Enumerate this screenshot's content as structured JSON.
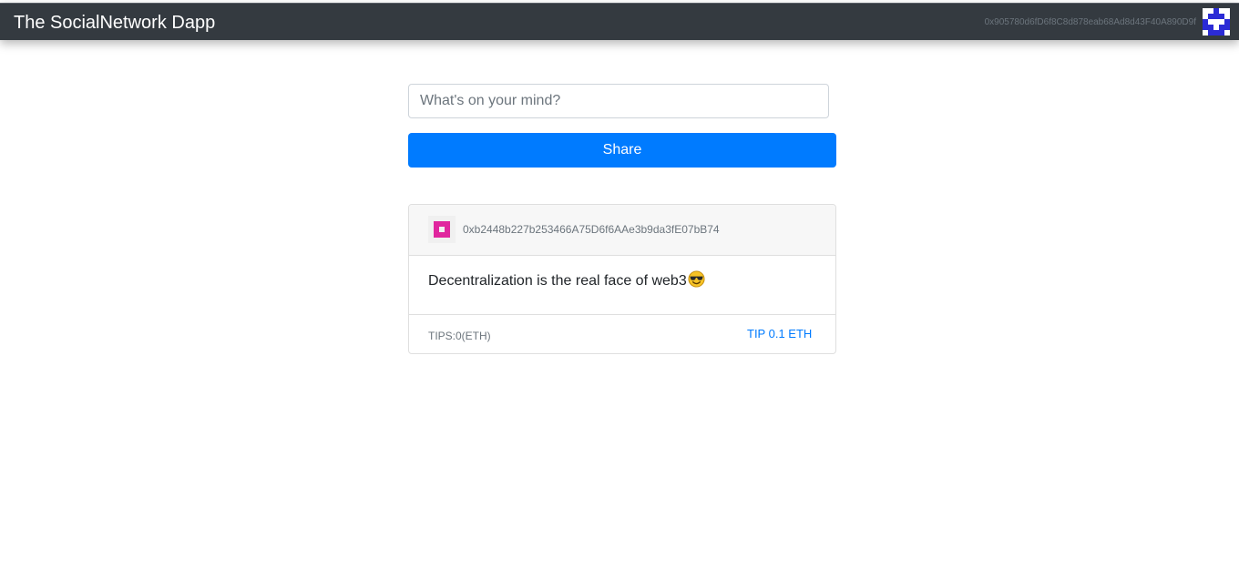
{
  "navbar": {
    "brand": "The SocialNetwork Dapp",
    "account": "0x905780d6fD6f8C8d878eab68Ad8d43F40A890D9f",
    "avatar_icon": "identicon-icon",
    "avatar_color": "#2b2bd6"
  },
  "composer": {
    "placeholder": "What's on your mind?",
    "value": "",
    "share_label": "Share",
    "share_color": "#007bff"
  },
  "posts": [
    {
      "author": "0xb2448b227b253466A75D6f6AAe3b9da3fE07bB74",
      "avatar_icon": "identicon-icon",
      "avatar_color": "#e0269e",
      "content": "Decentralization is the real face of web3",
      "content_emoji": "smiling-face-with-sunglasses-icon",
      "tips": "TIPS:0(ETH)",
      "tip_label": "TIP 0.1 ETH"
    }
  ]
}
